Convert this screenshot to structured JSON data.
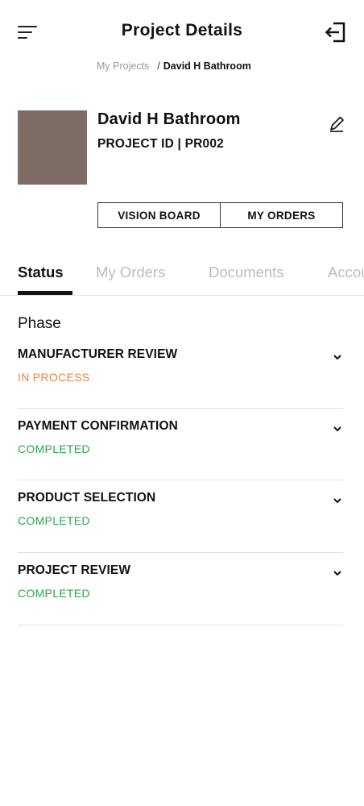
{
  "header": {
    "title": "Project Details",
    "menu_icon": "hamburger-menu-icon",
    "logout_icon": "logout-arrow-icon"
  },
  "breadcrumb": {
    "parent": "My Projects",
    "separator": "/",
    "current": "David H Bathroom"
  },
  "project": {
    "name": "David H Bathroom",
    "id_line": "PROJECT ID | PR002",
    "thumbnail_color": "#7d6b66",
    "edit_icon": "pencil-icon"
  },
  "actions": {
    "vision_board": "VISION BOARD",
    "my_orders": "MY ORDERS"
  },
  "tabs": [
    {
      "label": "Status",
      "active": true
    },
    {
      "label": "My Orders",
      "active": false
    },
    {
      "label": "Documents",
      "active": false
    },
    {
      "label": "Accounts",
      "active": false
    }
  ],
  "phase": {
    "heading": "Phase",
    "items": [
      {
        "name": "MANUFACTURER REVIEW",
        "status": "IN PROCESS",
        "status_color": "#e8843c"
      },
      {
        "name": "PAYMENT CONFIRMATION",
        "status": "COMPLETED",
        "status_color": "#2aa84a"
      },
      {
        "name": "PRODUCT SELECTION",
        "status": "COMPLETED",
        "status_color": "#2aa84a"
      },
      {
        "name": "PROJECT REVIEW",
        "status": "COMPLETED",
        "status_color": "#2aa84a"
      }
    ]
  },
  "colors": {
    "in_process": "#e8843c",
    "completed": "#2aa84a",
    "inactive_tab": "#bdbdbd"
  }
}
